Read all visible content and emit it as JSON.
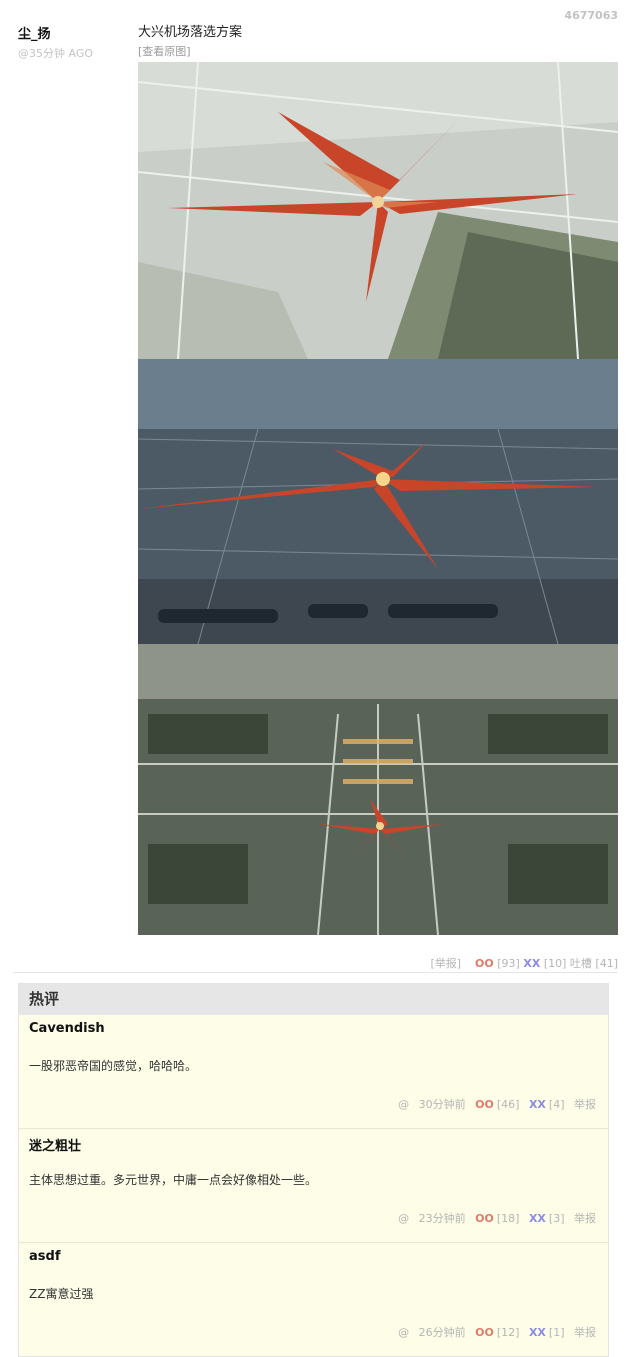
{
  "post": {
    "id": "4677063",
    "author": "尘_扬",
    "time": "@35分钟 AGO",
    "title": "大兴机场落选方案",
    "view_original": "[查看原图]",
    "footer": {
      "report": "[举报]",
      "oo_label": "OO",
      "oo_count": "[93]",
      "xx_label": "XX",
      "xx_count": "[10]",
      "tucao_label": "吐槽",
      "tucao_count": "[41]"
    }
  },
  "hot_comments": {
    "title": "热评",
    "items": [
      {
        "name": "Cavendish",
        "text": "一股邪恶帝国的感觉，哈哈哈。",
        "at": "@",
        "time": "30分钟前",
        "oo": "OO",
        "oo_count": "[46]",
        "xx": "XX",
        "xx_count": "[4]",
        "report": "举报"
      },
      {
        "name": "迷之粗壮",
        "text": "主体思想过重。多元世界，中庸一点会好像相处一些。",
        "at": "@",
        "time": "23分钟前",
        "oo": "OO",
        "oo_count": "[18]",
        "xx": "XX",
        "xx_count": "[3]",
        "report": "举报"
      },
      {
        "name": "asdf",
        "text": "ZZ寓意过强",
        "at": "@",
        "time": "26分钟前",
        "oo": "OO",
        "oo_count": "[12]",
        "xx": "XX",
        "xx_count": "[1]",
        "report": "举报"
      }
    ]
  },
  "colors": {
    "oo": "#e07a6a",
    "xx": "#8a8ae8",
    "hot_bg": "#fdfde8",
    "terminal_red": "#c8452a"
  }
}
